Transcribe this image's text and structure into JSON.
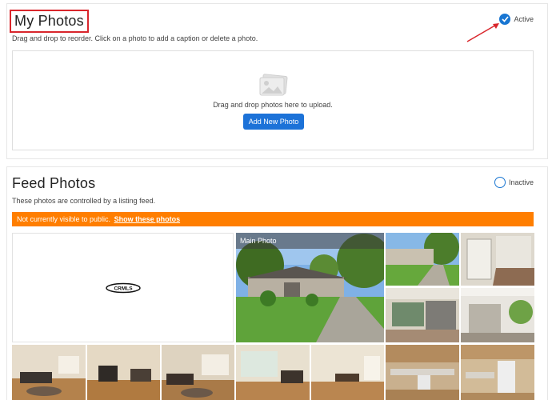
{
  "my_photos": {
    "title": "My Photos",
    "description": "Drag and drop to reorder. Click on a photo to add a caption or delete a photo.",
    "status_label": "Active",
    "dropzone_text": "Drag and drop photos here to upload.",
    "add_button": "Add New Photo"
  },
  "feed_photos": {
    "title": "Feed Photos",
    "description": "These photos are controlled by a listing feed.",
    "status_label": "Inactive",
    "notice_text": "Not currently visible to public.",
    "notice_link": "Show these photos",
    "main_photo_label": "Main Photo",
    "logo_text": "CRMLS"
  },
  "colors": {
    "accent_blue": "#1c72d8",
    "notice_orange": "#ff7e00",
    "highlight_red": "#d9262c"
  }
}
